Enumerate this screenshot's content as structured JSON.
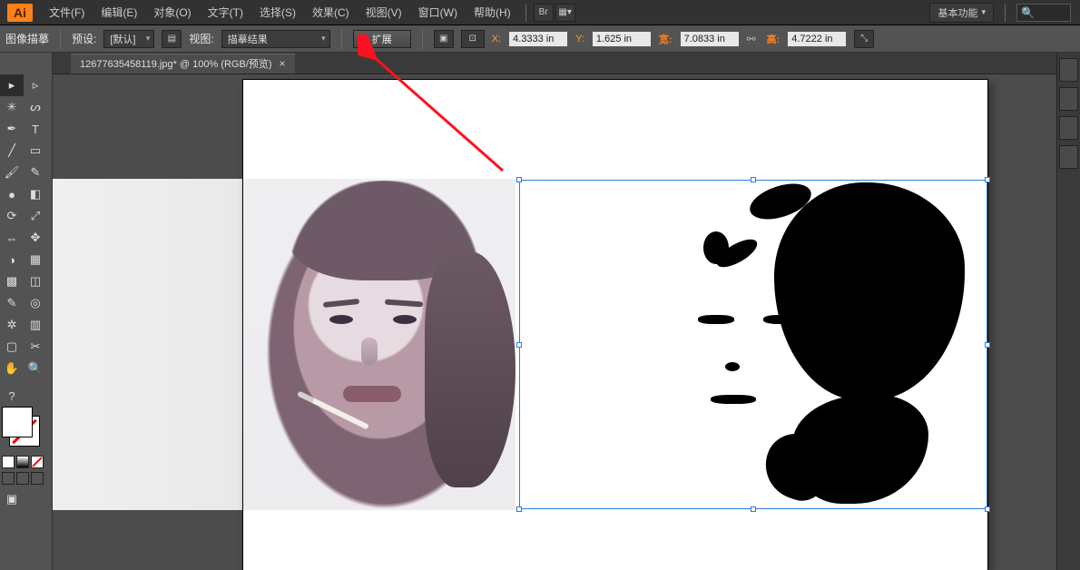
{
  "app": {
    "logo": "Ai"
  },
  "menu": [
    "文件(F)",
    "编辑(E)",
    "对象(O)",
    "文字(T)",
    "选择(S)",
    "效果(C)",
    "视图(V)",
    "窗口(W)",
    "帮助(H)"
  ],
  "top_right": {
    "workspace": "基本功能"
  },
  "controlbar": {
    "panel_name": "图像描摹",
    "preset_label": "预设:",
    "preset_value": "[默认]",
    "view_label": "视图:",
    "view_value": "描摹结果",
    "expand_btn": "扩展",
    "x_label": "X:",
    "x_value": "4.3333 in",
    "y_label": "Y:",
    "y_value": "1.625 in",
    "w_label": "宽:",
    "w_value": "7.0833 in",
    "h_label": "高:",
    "h_value": "4.7222 in"
  },
  "document_tab": {
    "title": "12677635458119.jpg* @ 100% (RGB/预览)",
    "close": "×"
  },
  "tools": [
    [
      "selection-tool",
      "▸"
    ],
    [
      "direct-selection-tool",
      "▹"
    ],
    [
      "magic-wand-tool",
      "✳"
    ],
    [
      "lasso-tool",
      "ᔕ"
    ],
    [
      "pen-tool",
      "✒"
    ],
    [
      "type-tool",
      "T"
    ],
    [
      "line-tool",
      "╱"
    ],
    [
      "rectangle-tool",
      "▭"
    ],
    [
      "paintbrush-tool",
      "🖌"
    ],
    [
      "pencil-tool",
      "✎"
    ],
    [
      "blob-brush-tool",
      "●"
    ],
    [
      "eraser-tool",
      "◧"
    ],
    [
      "rotate-tool",
      "⟳"
    ],
    [
      "scale-tool",
      "⤢"
    ],
    [
      "width-tool",
      "⇔"
    ],
    [
      "free-transform-tool",
      "✥"
    ],
    [
      "shape-builder-tool",
      "◑"
    ],
    [
      "perspective-grid-tool",
      "▦"
    ],
    [
      "mesh-tool",
      "▩"
    ],
    [
      "gradient-tool",
      "◫"
    ],
    [
      "eyedropper-tool",
      "✎"
    ],
    [
      "blend-tool",
      "◎"
    ],
    [
      "symbol-sprayer-tool",
      "✲"
    ],
    [
      "column-graph-tool",
      "▥"
    ],
    [
      "artboard-tool",
      "▢"
    ],
    [
      "slice-tool",
      "✂"
    ],
    [
      "hand-tool",
      "✋"
    ],
    [
      "zoom-tool",
      "🔍"
    ]
  ]
}
